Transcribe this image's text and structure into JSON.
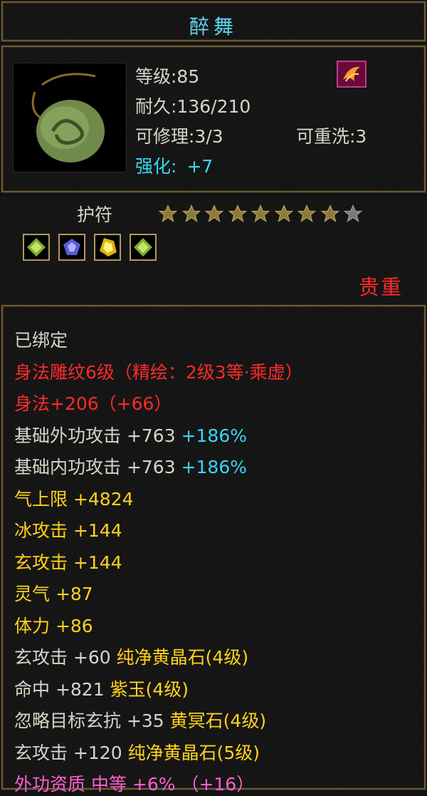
{
  "title": "醉舞",
  "header": {
    "level": "等级:85",
    "durability": "耐久:136/210",
    "repairable": "可修理:3/3",
    "rewash": "可重洗:3",
    "enhance_label": "强化:",
    "enhance_value": "+7"
  },
  "item_type": "护符",
  "stars": {
    "filled": 8,
    "total": 9
  },
  "gems": [
    "green-gem",
    "blue-gem",
    "yellow-gem",
    "green-gem"
  ],
  "quality": "贵重",
  "attributes": [
    {
      "parts": [
        {
          "text": "已绑定",
          "color": "white"
        }
      ]
    },
    {
      "parts": [
        {
          "text": "身法雕纹6级（精绘：2级3等·乘虚）",
          "color": "red"
        }
      ]
    },
    {
      "parts": [
        {
          "text": "身法+206（+66）",
          "color": "red"
        }
      ]
    },
    {
      "parts": [
        {
          "text": "基础外功攻击 +763 ",
          "color": "white"
        },
        {
          "text": "+186%",
          "color": "cyan"
        }
      ]
    },
    {
      "parts": [
        {
          "text": "基础内功攻击 +763 ",
          "color": "white"
        },
        {
          "text": "+186%",
          "color": "cyan"
        }
      ]
    },
    {
      "parts": [
        {
          "text": "气上限 +4824",
          "color": "yellow"
        }
      ]
    },
    {
      "parts": [
        {
          "text": "冰攻击 +144",
          "color": "yellow"
        }
      ]
    },
    {
      "parts": [
        {
          "text": "玄攻击 +144",
          "color": "yellow"
        }
      ]
    },
    {
      "parts": [
        {
          "text": "灵气 +87",
          "color": "yellow"
        }
      ]
    },
    {
      "parts": [
        {
          "text": "体力 +86",
          "color": "yellow"
        }
      ]
    },
    {
      "parts": [
        {
          "text": "玄攻击 +60 ",
          "color": "white"
        },
        {
          "text": "纯净黄晶石(4级)",
          "color": "yellow"
        }
      ]
    },
    {
      "parts": [
        {
          "text": "命中 +821 ",
          "color": "white"
        },
        {
          "text": "紫玉(4级)",
          "color": "yellow"
        }
      ]
    },
    {
      "parts": [
        {
          "text": "忽略目标玄抗 +35 ",
          "color": "white"
        },
        {
          "text": "黄冥石(4级)",
          "color": "yellow"
        }
      ]
    },
    {
      "parts": [
        {
          "text": "玄攻击 +120 ",
          "color": "white"
        },
        {
          "text": "纯净黄晶石(5级)",
          "color": "yellow"
        }
      ]
    },
    {
      "parts": [
        {
          "text": "外功资质 中等 +6% （+16）",
          "color": "pink"
        }
      ]
    }
  ]
}
